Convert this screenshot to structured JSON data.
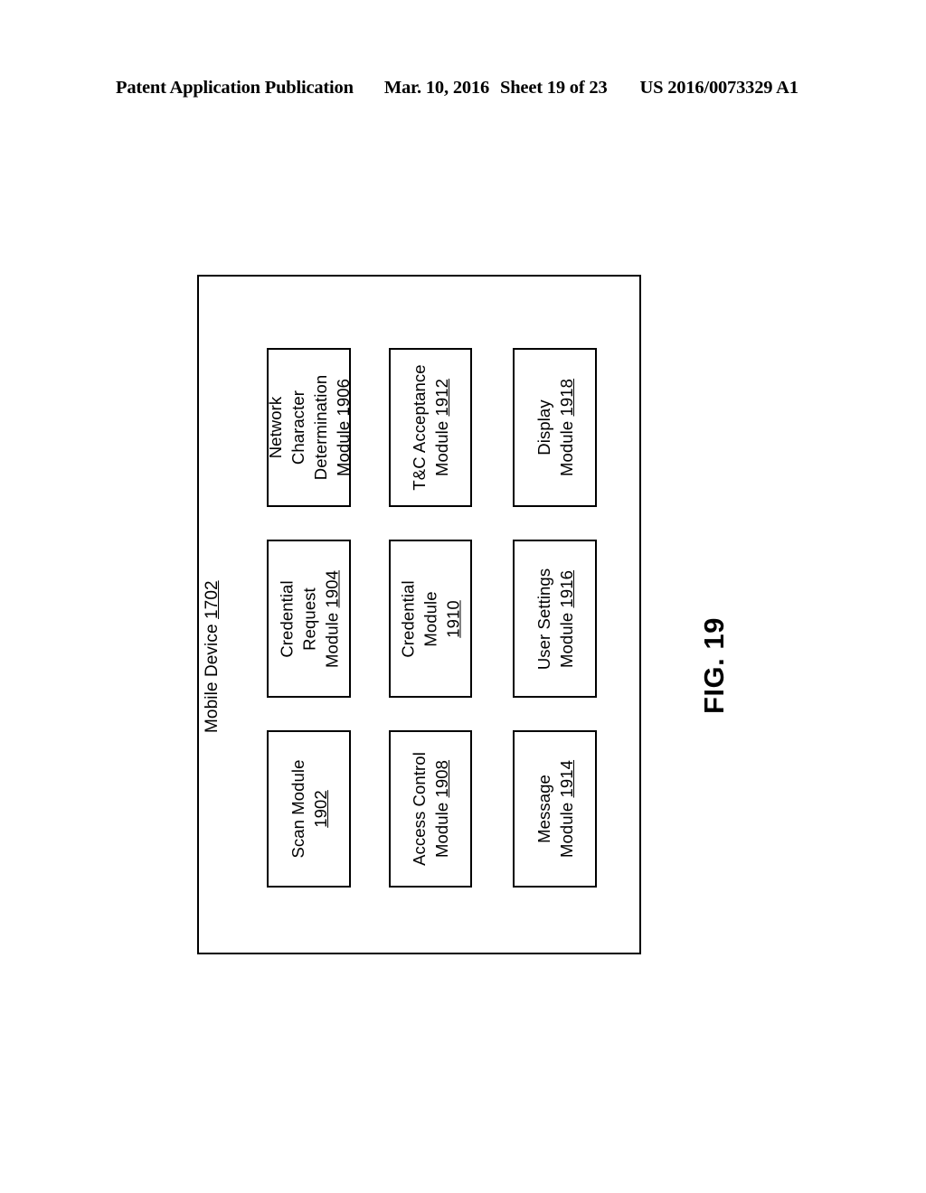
{
  "header": {
    "publication": "Patent Application Publication",
    "date": "Mar. 10, 2016",
    "sheet": "Sheet 19 of 23",
    "document_number": "US 2016/0073329 A1"
  },
  "figure": {
    "caption": "FIG. 19",
    "container": {
      "label_text": "Mobile Device ",
      "label_number": "1702"
    },
    "modules": [
      {
        "id": "network-character-determination-module",
        "lines": [
          "Network",
          "Character",
          "Determination",
          "Module "
        ],
        "number": "1906"
      },
      {
        "id": "tc-acceptance-module",
        "lines": [
          "T&C Acceptance",
          "Module "
        ],
        "number": "1912"
      },
      {
        "id": "display-module",
        "lines": [
          "Display",
          "Module "
        ],
        "number": "1918"
      },
      {
        "id": "credential-request-module",
        "lines": [
          "Credential",
          "Request",
          "Module "
        ],
        "number": "1904"
      },
      {
        "id": "credential-module",
        "lines": [
          "Credential",
          "Module",
          ""
        ],
        "number": "1910"
      },
      {
        "id": "user-settings-module",
        "lines": [
          "User Settings",
          "Module "
        ],
        "number": "1916"
      },
      {
        "id": "scan-module",
        "lines": [
          "Scan Module",
          ""
        ],
        "number": "1902"
      },
      {
        "id": "access-control-module",
        "lines": [
          "Access Control",
          "Module "
        ],
        "number": "1908"
      },
      {
        "id": "message-module",
        "lines": [
          "Message",
          "Module "
        ],
        "number": "1914"
      }
    ]
  }
}
